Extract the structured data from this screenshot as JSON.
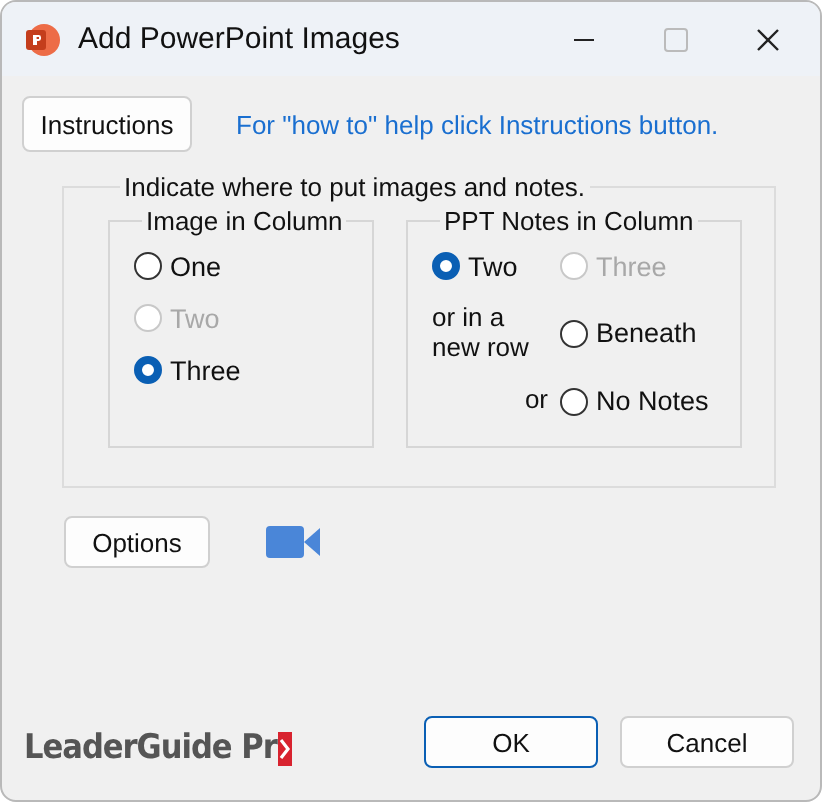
{
  "window": {
    "title": "Add PowerPoint Images"
  },
  "instructions_button": "Instructions",
  "help_text": "For \"how to\" help click Instructions button.",
  "placement_group": {
    "legend": "Indicate where to put images and notes.",
    "image_group": {
      "legend": "Image in Column",
      "options": [
        {
          "label": "One",
          "selected": false,
          "disabled": false
        },
        {
          "label": "Two",
          "selected": false,
          "disabled": true
        },
        {
          "label": "Three",
          "selected": true,
          "disabled": false
        }
      ]
    },
    "notes_group": {
      "legend": "PPT Notes in Column",
      "items": [
        {
          "kind": "radio",
          "label": "Two",
          "selected": true,
          "disabled": false
        },
        {
          "kind": "radio",
          "label": "Three",
          "selected": false,
          "disabled": true
        },
        {
          "kind": "text",
          "label": "or in a new row"
        },
        {
          "kind": "radio",
          "label": "Beneath",
          "selected": false,
          "disabled": false
        },
        {
          "kind": "or",
          "label": "or"
        },
        {
          "kind": "radio",
          "label": "No Notes",
          "selected": false,
          "disabled": false
        }
      ]
    }
  },
  "options_button": "Options",
  "logo": "LeaderGuide Pr",
  "buttons": [
    {
      "label": "OK",
      "default": true
    },
    {
      "label": "Cancel",
      "default": false
    }
  ]
}
